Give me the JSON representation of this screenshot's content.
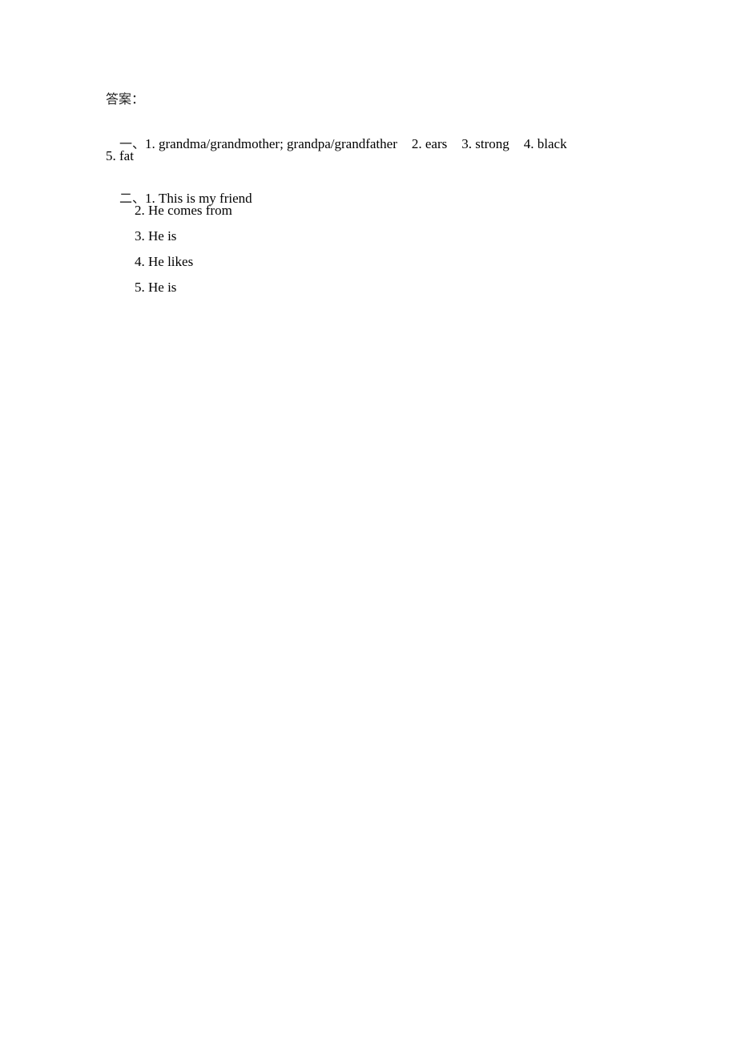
{
  "doc": {
    "heading": "答案：",
    "section1": {
      "marker": "一、",
      "items": [
        "1. grandma/grandmother; grandpa/grandfather",
        "2. ears",
        "3. strong",
        "4. black",
        "5. fat"
      ]
    },
    "section2": {
      "marker": "二、",
      "items": [
        "1. This is my friend",
        "2. He comes from",
        "3. He is",
        "4. He likes",
        "5. He is"
      ]
    }
  }
}
